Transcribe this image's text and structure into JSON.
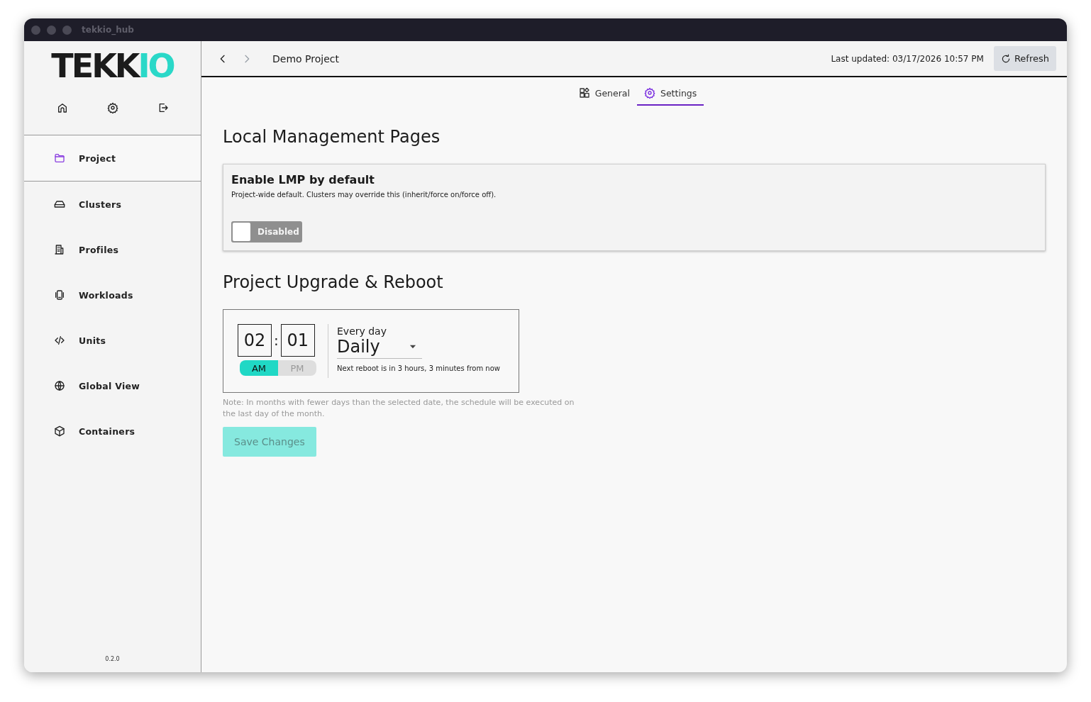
{
  "window": {
    "title": "tekkio_hub"
  },
  "logo": {
    "parts": [
      {
        "text": "TEKK",
        "color": "#1b1b1b"
      },
      {
        "text": "IO",
        "color": "#2ad8c8"
      }
    ]
  },
  "sidebar": {
    "items": [
      {
        "label": "Project",
        "selected": true
      },
      {
        "label": "Clusters",
        "selected": false
      },
      {
        "label": "Profiles",
        "selected": false
      },
      {
        "label": "Workloads",
        "selected": false
      },
      {
        "label": "Units",
        "selected": false
      },
      {
        "label": "Global View",
        "selected": false
      },
      {
        "label": "Containers",
        "selected": false
      }
    ],
    "version": "0.2.0"
  },
  "header": {
    "back_disabled": false,
    "forward_disabled": true,
    "title": "Demo Project",
    "last_updated": "Last updated: 03/17/2026 10:57 PM",
    "refresh": "Refresh"
  },
  "tabs": [
    {
      "label": "General",
      "selected": false
    },
    {
      "label": "Settings",
      "selected": true
    }
  ],
  "lmp": {
    "heading": "Local Management Pages",
    "card_title": "Enable LMP by default",
    "description": "Project-wide default. Clusters may override this (inherit/force on/force off).",
    "toggle": {
      "on": false,
      "label": "Disabled"
    }
  },
  "upgrade": {
    "heading": "Project Upgrade & Reboot",
    "hour": "02",
    "separator": ":",
    "minute": "01",
    "periods": [
      {
        "label": "AM",
        "selected": true
      },
      {
        "label": "PM",
        "selected": false
      }
    ],
    "frequency_label": "Every day",
    "frequency": "Daily",
    "next_reboot": "Next reboot is in 3 hours, 3 minutes from now",
    "note": "Note: In months with fewer days than the selected date, the schedule will be executed on the last day of the month.",
    "save": {
      "label": "Save Changes",
      "disabled": true
    }
  }
}
